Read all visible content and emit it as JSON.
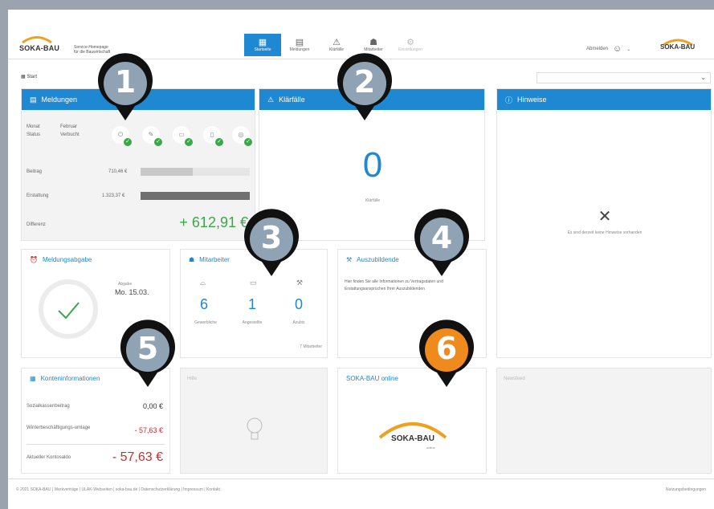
{
  "header": {
    "logo": "SOKA-BAU",
    "tagline_1": "Service-Homepage",
    "tagline_2": "für die Bauwirtschaft",
    "nav": [
      {
        "label": "Startseite",
        "icon": "grid-icon",
        "glyph": "▦"
      },
      {
        "label": "Meldungen",
        "icon": "calendar-icon",
        "glyph": "▤"
      },
      {
        "label": "Klärfälle",
        "icon": "warning-icon",
        "glyph": "⚠"
      },
      {
        "label": "Mitarbeiter",
        "icon": "worker-icon",
        "glyph": "☗"
      },
      {
        "label": "Einstellungen",
        "icon": "gear-icon",
        "glyph": "⚙"
      }
    ],
    "user_label": "Abmelden",
    "right_logo": "SOKA-BAU"
  },
  "breadcrumb": "Start",
  "meldungen": {
    "title": "Meldungen",
    "monat_label": "Monat",
    "monat_value": "Februar",
    "status_label": "Status",
    "status_value": "Verbucht",
    "beitrag_label": "Beitrag",
    "beitrag_value": "710,46 €",
    "beitrag_fill": 0.48,
    "erstattung_label": "Erstattung",
    "erstattung_value": "1.323,37 €",
    "erstattung_fill": 1.0,
    "differenz_label": "Differenz",
    "differenz_value": "+ 612,91 €"
  },
  "klaerfaelle": {
    "title": "Klärfälle",
    "count": "0",
    "label": "Klärfälle"
  },
  "hinweise": {
    "title": "Hinweise",
    "empty": "Es sind derzeit keine Hinweise vorhanden"
  },
  "meldungsabgabe": {
    "title": "Meldungsabgabe",
    "date_label": "Abgabe",
    "date_value": "Mo. 15.03."
  },
  "mitarbeiter": {
    "title": "Mitarbeiter",
    "cols": [
      {
        "count": "6",
        "label": "Gewerbliche"
      },
      {
        "count": "1",
        "label": "Angestellte"
      },
      {
        "count": "0",
        "label": "Azubis"
      }
    ],
    "total": "7 Mitarbeiter"
  },
  "auszubildende": {
    "title": "Auszubildende",
    "text": "Hier finden Sie alle Informationen zu Vertragsdaten und Erstattungsansprüchen Ihrer Auszubildenden"
  },
  "konten": {
    "title": "Konteninformationen",
    "rows": [
      {
        "label": "Sozialkassenbeitrag",
        "value": "0,00 €"
      },
      {
        "label": "Winterbeschäftigungs-umlage",
        "value": "- 57,63 €"
      }
    ],
    "saldo_label": "Aktueller Kontosaldo",
    "saldo_value": "- 57,63 €"
  },
  "hilfe": {
    "title": "Hilfe"
  },
  "online": {
    "title": "SOKA-BAU online",
    "logo": "SOKA-BAU",
    "logo_sub": "online"
  },
  "newsfeed": {
    "title": "Newsfeed"
  },
  "footer": {
    "left": "© 2021 SOKA-BAU  |  Werkverträge  |  ULAK-Webseiten  |  soka-bau.de  |  Datenschutzerklärung  |  Impressum  |  Kontakt",
    "right": "Nutzungsbedingungen"
  },
  "pins": [
    {
      "num": "1",
      "color": "#8fa3b5"
    },
    {
      "num": "2",
      "color": "#8fa3b5"
    },
    {
      "num": "3",
      "color": "#8fa3b5"
    },
    {
      "num": "4",
      "color": "#8fa3b5"
    },
    {
      "num": "5",
      "color": "#8fa3b5"
    },
    {
      "num": "6",
      "color": "#ef8a1c"
    }
  ]
}
